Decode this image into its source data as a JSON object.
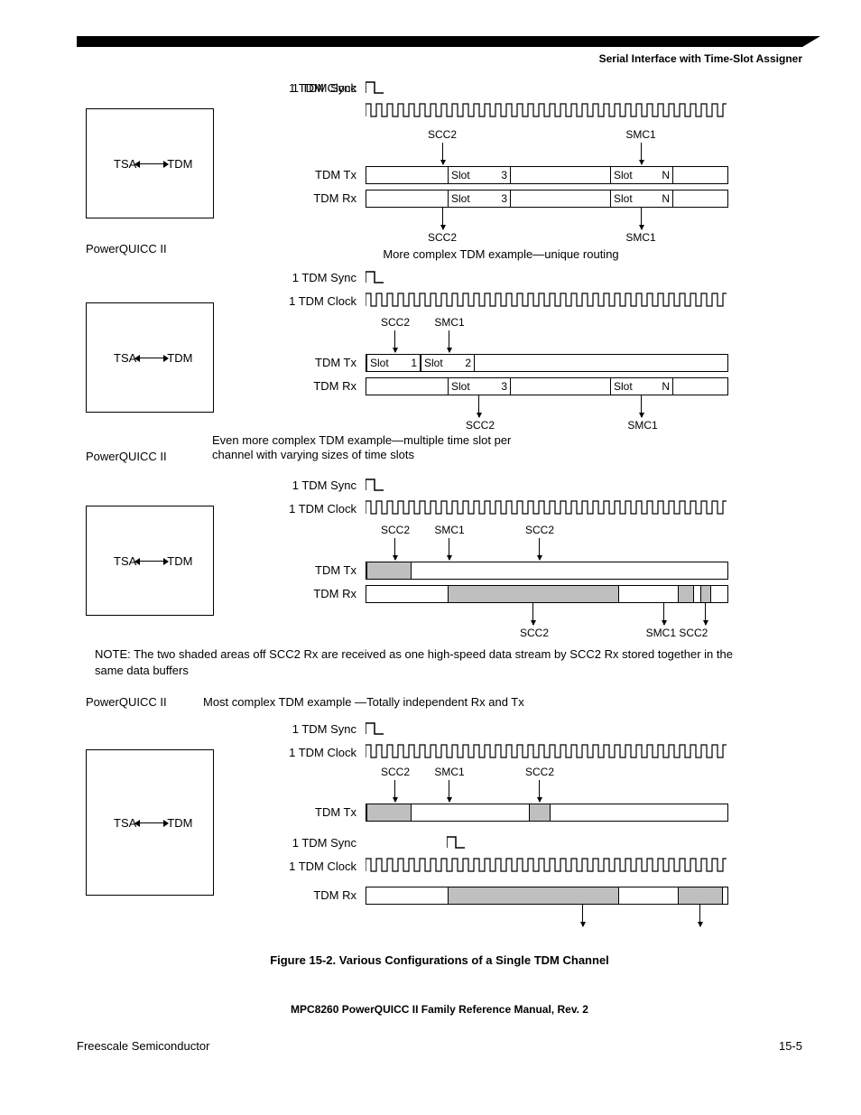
{
  "header": {
    "section": "Serial Interface with Time-Slot Assigner"
  },
  "common": {
    "pq": "PowerQUICC II",
    "tsa": "TSA",
    "tdm": "TDM",
    "sync": "1 TDM Sync",
    "clock": "1 TDM Clock",
    "tx": "TDM Tx",
    "rx": "TDM Rx",
    "scc2": "SCC2",
    "smc1": "SMC1",
    "slot1": "Slot",
    "n1": "1",
    "slot2": "Slot",
    "n2": "2",
    "slot3": "Slot",
    "n3": "3",
    "slotN": "Slot",
    "nN": "N"
  },
  "ex1": {
    "caption": "More complex TDM example—unique routing"
  },
  "ex2": {
    "caption1": "Even more complex TDM example—multiple time slot per",
    "caption2": "channel with varying sizes of time slots"
  },
  "ex3": {
    "note": "NOTE: The two shaded areas off SCC2 Rx are received as one high-speed data stream by SCC2 Rx stored together in the same data buffers",
    "caption": "Most complex TDM example —Totally independent Rx and Tx",
    "scc2b": "SCC2",
    "smc1scc2": "SMC1 SCC2"
  },
  "figure": {
    "caption": "Figure 15-2. Various Configurations of a Single TDM Channel"
  },
  "footer": {
    "manual": "MPC8260 PowerQUICC II Family Reference Manual, Rev. 2",
    "company": "Freescale Semiconductor",
    "page": "15-5"
  }
}
